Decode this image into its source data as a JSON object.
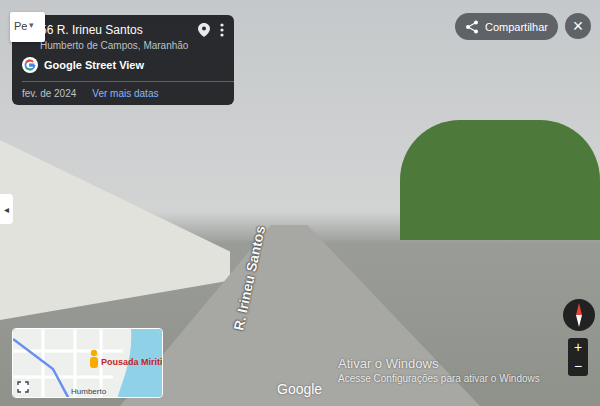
{
  "search": {
    "text": "Pe",
    "arrow": "▾"
  },
  "location_card": {
    "address": "56 R. Irineu Santos",
    "locality": "Humberto de Campos, Maranhão",
    "source": "Google Street View",
    "date": "fev. de 2024",
    "more_dates": "Ver mais datas"
  },
  "share_button": {
    "label": "Compartilhar"
  },
  "close_button": {
    "label": "×"
  },
  "street_label": "R. Irineu Santos",
  "minimap": {
    "place": "Pousada Miriti",
    "town": "Humberto"
  },
  "zoom": {
    "in": "+",
    "out": "−"
  },
  "side_toggle": "◂",
  "watermark": "Google",
  "windows_notice": [
    "Ativar o Windows",
    "Acesse Configurações para ativar o Windows"
  ]
}
